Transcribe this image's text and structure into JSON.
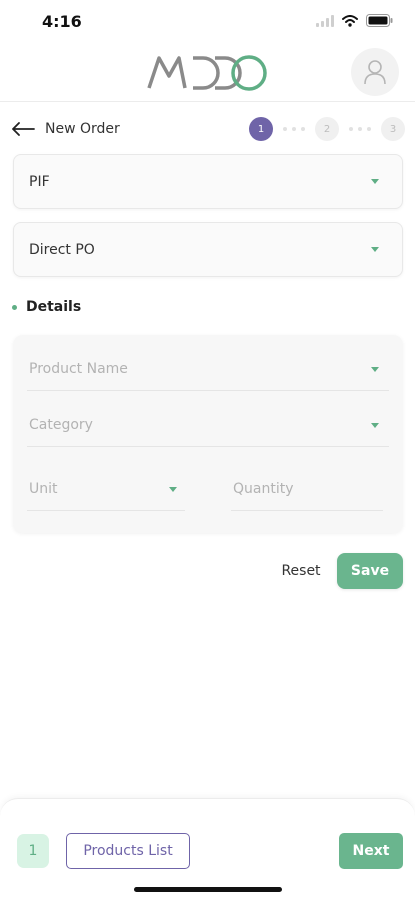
{
  "status_bar": {
    "time": "4:16"
  },
  "header": {
    "logo_text": "MDDO",
    "brand_color": "#5fae85",
    "logo_gray": "#8a8a8a"
  },
  "order": {
    "title": "New Order",
    "steps": [
      "1",
      "2",
      "3"
    ],
    "current_step": 1
  },
  "selects": {
    "type_value": "PIF",
    "po_value": "Direct PO"
  },
  "details": {
    "label": "Details",
    "product_placeholder": "Product Name",
    "category_placeholder": "Category",
    "unit_placeholder": "Unit",
    "quantity_placeholder": "Quantity"
  },
  "actions": {
    "reset_label": "Reset",
    "save_label": "Save"
  },
  "footer": {
    "count": "1",
    "products_label": "Products List",
    "next_label": "Next"
  },
  "colors": {
    "primary": "#6ab58e",
    "accent": "#6f64a8"
  }
}
